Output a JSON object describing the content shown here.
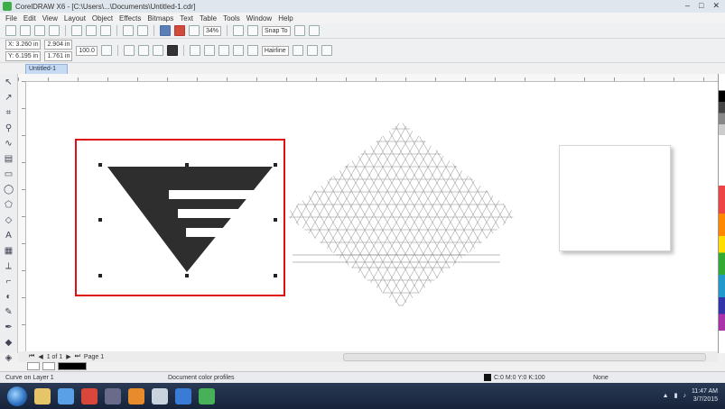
{
  "window": {
    "title": "CorelDRAW X6 - [C:\\Users\\...\\Documents\\Untitled-1.cdr]",
    "controls": [
      "–",
      "□",
      "✕"
    ]
  },
  "menu": [
    "File",
    "Edit",
    "View",
    "Layout",
    "Object",
    "Effects",
    "Bitmaps",
    "Text",
    "Table",
    "Tools",
    "Window",
    "Help"
  ],
  "toolbar1": {
    "zoom_value": "34%",
    "snap_label": "Snap To"
  },
  "toolbar2": {
    "x_value": "X: 3.260 in",
    "y_value": "Y: 6.195 in",
    "w_value": "2.904 in",
    "h_value": "1.761 in",
    "scale_value": "100.0",
    "outline_value": "Hairline"
  },
  "doc_tab": "Untitled-1",
  "toolbox_icons": [
    "pick-icon",
    "shape-icon",
    "crop-icon",
    "zoom-icon",
    "freehand-icon",
    "smart-fill-icon",
    "rectangle-icon",
    "ellipse-icon",
    "polygon-icon",
    "text-icon",
    "table-icon",
    "dimension-icon",
    "connector-icon",
    "interactive-icon",
    "eyedropper-icon",
    "outline-icon",
    "fill-icon",
    "interactive-fill-icon"
  ],
  "page_nav": {
    "page_counter": "1 of 1",
    "page_tab": "Page 1"
  },
  "status": {
    "left_text": "Curve on Layer 1",
    "doc_info": "Document color profiles",
    "fill_label": "C:0 M:0 Y:0 K:100",
    "outline_label": "None"
  },
  "taskbar": {
    "time": "11:47 AM",
    "date": "3/7/2015"
  },
  "colors": {
    "highlight": "#e01010",
    "taskbar": "#1c2b45",
    "shape_fill": "#2e2e2e"
  }
}
